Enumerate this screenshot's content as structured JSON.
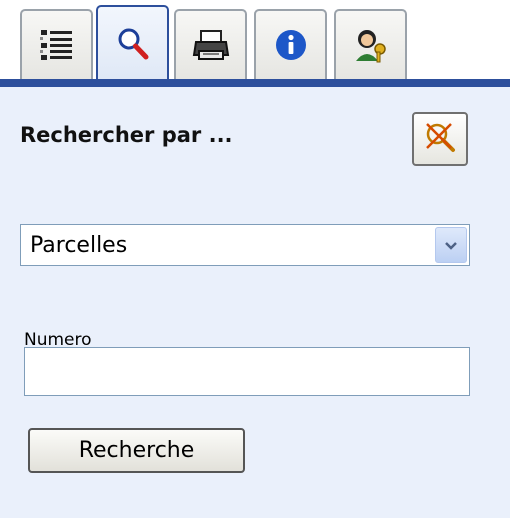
{
  "tabs": [
    {
      "icon": "list-icon",
      "active": false
    },
    {
      "icon": "magnifier-icon",
      "active": true
    },
    {
      "icon": "printer-icon",
      "active": false
    },
    {
      "icon": "info-icon",
      "active": false
    },
    {
      "icon": "user-key-icon",
      "active": false
    }
  ],
  "search_panel": {
    "title": "Rechercher par ...",
    "clear_icon": "clear-search-icon",
    "type_select": {
      "selected": "Parcelles"
    },
    "field_label": "Numero",
    "field_value": "",
    "submit_label": "Recherche"
  },
  "colors": {
    "tab_strip": "#2d4f9c",
    "panel_background": "#eaf0fb",
    "info_blue": "#1d57c8"
  }
}
